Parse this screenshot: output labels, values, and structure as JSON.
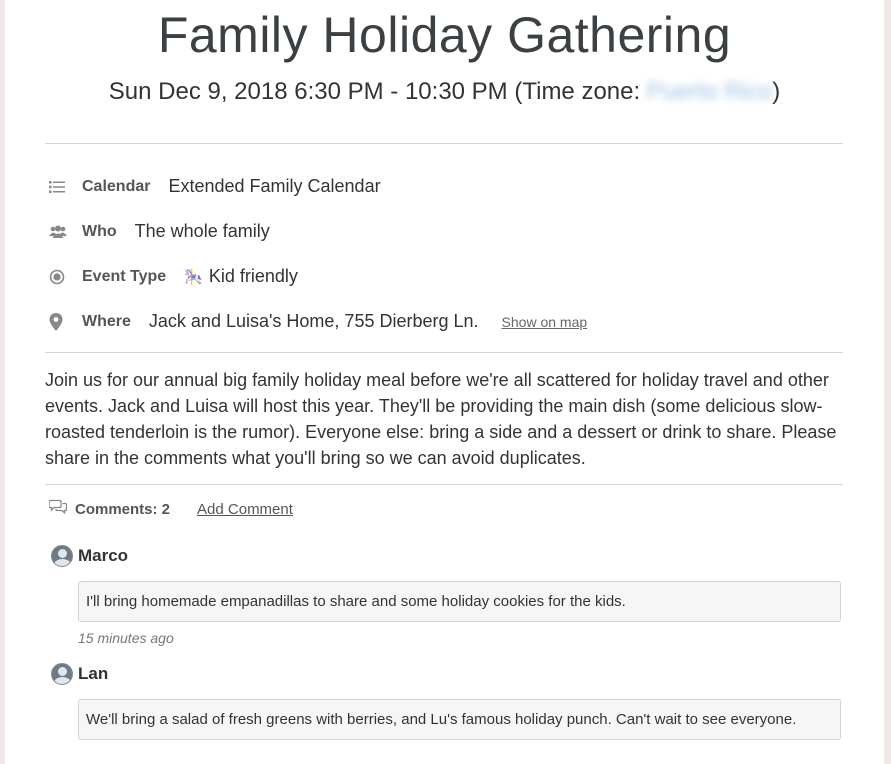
{
  "event": {
    "title": "Family Holiday Gathering",
    "datetime_prefix": "Sun Dec 9, 2018 6:30 PM - 10:30 PM (Time zone: ",
    "timezone_value": "Puerto Rico",
    "datetime_suffix": ")"
  },
  "details": {
    "calendar": {
      "icon": "list-icon",
      "label": "Calendar",
      "value": "Extended Family Calendar"
    },
    "who": {
      "icon": "people-icon",
      "label": "Who",
      "value": "The whole family"
    },
    "event_type": {
      "icon": "radio-target-icon",
      "label": "Event Type",
      "emoji": "🎠",
      "value": "Kid friendly"
    },
    "where": {
      "icon": "map-pin-icon",
      "label": "Where",
      "value": "Jack and Luisa's Home, 755 Dierberg Ln.",
      "map_link": "Show on map"
    }
  },
  "description": "Join us for our annual big family holiday meal before we're all scattered for holiday travel and other events. Jack and Luisa will host this year. They'll be providing the main dish (some delicious slow-roasted tenderloin is the rumor). Everyone else: bring a side and a dessert or drink to share. Please share in the comments what you'll bring so we can avoid duplicates.",
  "comments": {
    "icon": "speech-bubbles-icon",
    "count_label": "Comments: 2",
    "add_label": "Add Comment",
    "items": [
      {
        "author": "Marco",
        "text": "I'll bring homemade empanadillas to share and some holiday cookies for the kids.",
        "time": "15 minutes ago"
      },
      {
        "author": "Lan",
        "text": "We'll bring a salad of fresh greens with berries, and Lu's famous holiday punch. Can't wait to see everyone.",
        "time": ""
      }
    ]
  },
  "colors": {
    "title": "#3b4043",
    "text": "#333333",
    "muted": "#777777",
    "divider": "#d6d6d6",
    "comment_bg": "#f6f6f6",
    "timezone_blur": "#9bc0e6"
  }
}
